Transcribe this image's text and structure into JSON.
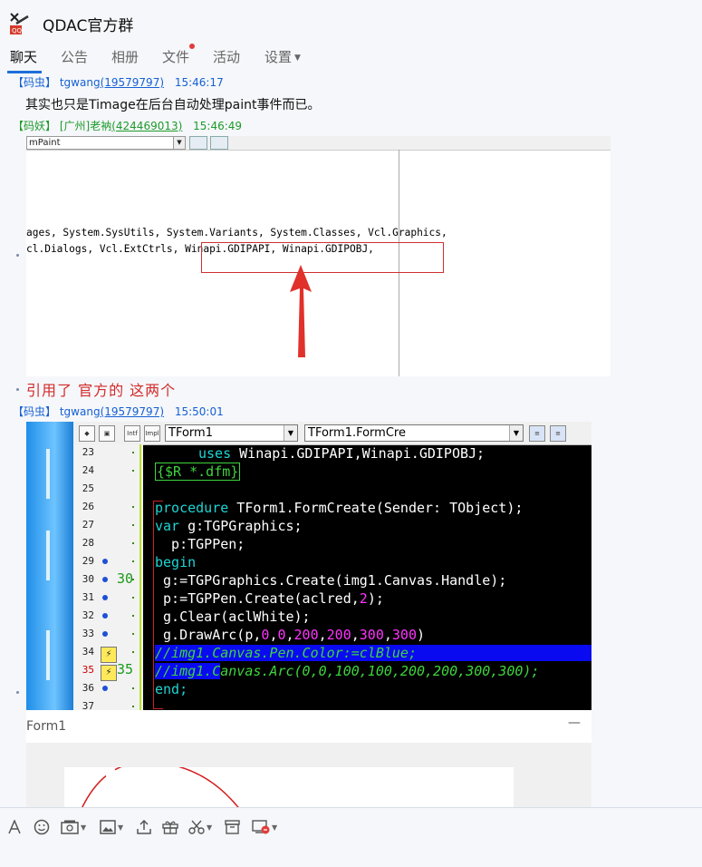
{
  "group": {
    "title": "QDAC官方群"
  },
  "tabs": [
    {
      "label": "聊天",
      "active": true
    },
    {
      "label": "公告"
    },
    {
      "label": "相册"
    },
    {
      "label": "文件",
      "has_badge": true
    },
    {
      "label": "活动"
    },
    {
      "label": "设置",
      "has_dropdown": true
    }
  ],
  "messages": [
    {
      "role": "【码虫】",
      "name": "tgwang",
      "qq": "(19579797)",
      "time": "15:46:17",
      "text": "其实也只是Timage在后台自动处理paint事件而已。"
    },
    {
      "role": "【码妖】",
      "name": "[广州]老衲",
      "qq": "(424469013)",
      "time": "15:46:49",
      "text": "引用了  官方的  这两个"
    },
    {
      "role": "【码虫】",
      "name": "tgwang",
      "qq": "(19579797)",
      "time": "15:50:01"
    }
  ],
  "screenshot1": {
    "combo_text": "mPaint",
    "line1": "ages, System.SysUtils, System.Variants, System.Classes, Vcl.Graphics,",
    "line2": "cl.Dialogs, Vcl.ExtCtrls, Winapi.GDIPAPI, Winapi.GDIPOBJ,"
  },
  "screenshot2": {
    "combo_form": "TForm1",
    "combo_method": "TForm1.FormCre",
    "line_numbers": [
      "23",
      "24",
      "25",
      "26",
      "27",
      "28",
      "29",
      "30",
      "31",
      "32",
      "33",
      "34",
      "35",
      "36",
      "37"
    ],
    "marker_30": "30",
    "marker_35": "35",
    "code": {
      "l23_kw": "uses",
      "l23_rest": " Winapi.GDIPAPI,Winapi.GDIPOBJ;",
      "l24": "{$R *.dfm}",
      "l26_kw": "procedure",
      "l26_rest": " TForm1.FormCreate(Sender: TObject);",
      "l27_kw": "var",
      "l27_rest": " g:TGPGraphics;",
      "l28": "  p:TGPPen;",
      "l29": "begin",
      "l30": " g:=TGPGraphics.Create(img1.Canvas.Handle);",
      "l31_a": " p:=TGPPen.Create(aclred,",
      "l31_n": "2",
      "l31_b": ");",
      "l32": " g.Clear(aclWhite);",
      "l33_a": " g.DrawArc(p,",
      "l33_nums": [
        "0",
        "0",
        "200",
        "200",
        "300",
        "300"
      ],
      "l33_b": ")",
      "l34": "//img1.Canvas.Pen.Color:=clBlue;",
      "l35_sel": "//img1.C",
      "l35_rest": "anvas.Arc(0,0,100,100,200,200,300,300);",
      "l36": "end;"
    }
  },
  "form_preview": {
    "title": "Form1",
    "min_symbol": "—"
  },
  "toolbar_icons": [
    "font-icon",
    "emoji-icon",
    "screenshot-icon",
    "image-icon",
    "upload-icon",
    "gift-icon",
    "scissors-icon",
    "archive-icon",
    "shake-icon"
  ]
}
